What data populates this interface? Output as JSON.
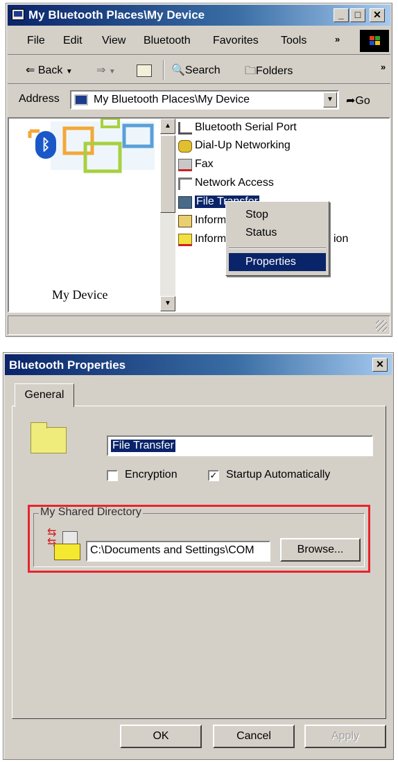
{
  "explorer": {
    "title": "My Bluetooth Places\\My Device",
    "menu": [
      "File",
      "Edit",
      "View",
      "Bluetooth",
      "Favorites",
      "Tools"
    ],
    "toolbar": {
      "back": "Back",
      "search": "Search",
      "folders": "Folders"
    },
    "address": {
      "label": "Address",
      "value": "My Bluetooth Places\\My Device",
      "go": "Go"
    },
    "device_label": "My Device",
    "services": [
      "Bluetooth Serial Port",
      "Dial-Up Networking",
      "Fax",
      "Network Access",
      "File Transfer",
      "Inform",
      "Inform"
    ],
    "service_suffix": "ion",
    "context_menu": [
      "Stop",
      "Status",
      "Properties"
    ]
  },
  "dialog": {
    "title": "Bluetooth Properties",
    "tab": "General",
    "name_value": "File Transfer",
    "encryption": {
      "label": "Encryption",
      "checked": false
    },
    "startup": {
      "label": "Startup Automatically",
      "checked": true
    },
    "group_label": "My Shared Directory",
    "path_value": "C:\\Documents and Settings\\COM",
    "browse": "Browse...",
    "buttons": {
      "ok": "OK",
      "cancel": "Cancel",
      "apply": "Apply"
    }
  },
  "colors": {
    "titlebar": "#0a246a",
    "highlight": "#0a246a",
    "annotation": "#e8242b",
    "face": "#d4d0c8"
  }
}
